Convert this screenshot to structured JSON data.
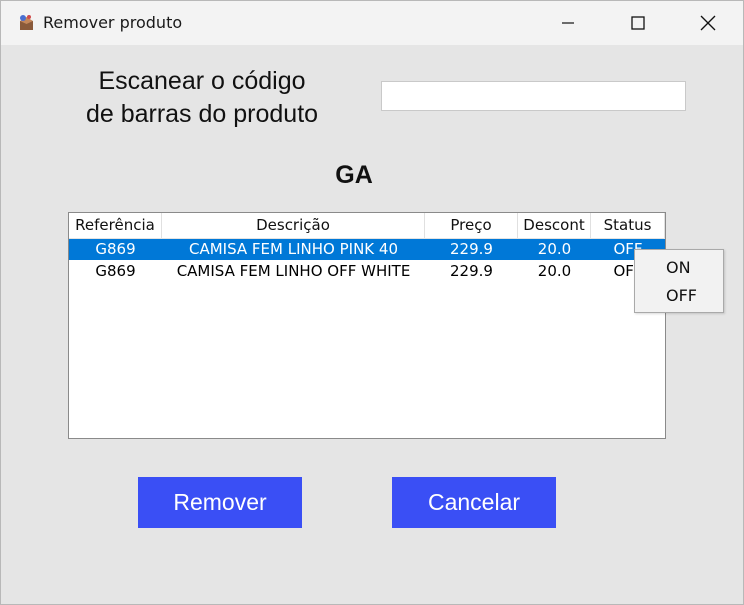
{
  "window": {
    "title": "Remover produto",
    "app_icon": "box-icon"
  },
  "titlebar_buttons": {
    "minimize_icon": "minimize-icon",
    "maximize_icon": "maximize-icon",
    "close_icon": "close-icon"
  },
  "scan": {
    "label_line1": "Escanear o código",
    "label_line2": "de barras do produto",
    "value": "",
    "placeholder": ""
  },
  "store_label": "GA",
  "table": {
    "columns": [
      "Referência",
      "Descrição",
      "Preço",
      "Descont",
      "Status"
    ],
    "rows": [
      {
        "ref": "G869",
        "desc": "CAMISA FEM LINHO PINK 40",
        "price": "229.9",
        "discount": "20.0",
        "status": "OFF",
        "selected": true
      },
      {
        "ref": "G869",
        "desc": "CAMISA FEM LINHO OFF WHITE",
        "price": "229.9",
        "discount": "20.0",
        "status": "OFF",
        "selected": false
      }
    ]
  },
  "status_popup": {
    "options": [
      "ON",
      "OFF"
    ]
  },
  "buttons": {
    "remove": "Remover",
    "cancel": "Cancelar"
  },
  "colors": {
    "accent": "#3a4ff5",
    "selection": "#0078d7"
  }
}
